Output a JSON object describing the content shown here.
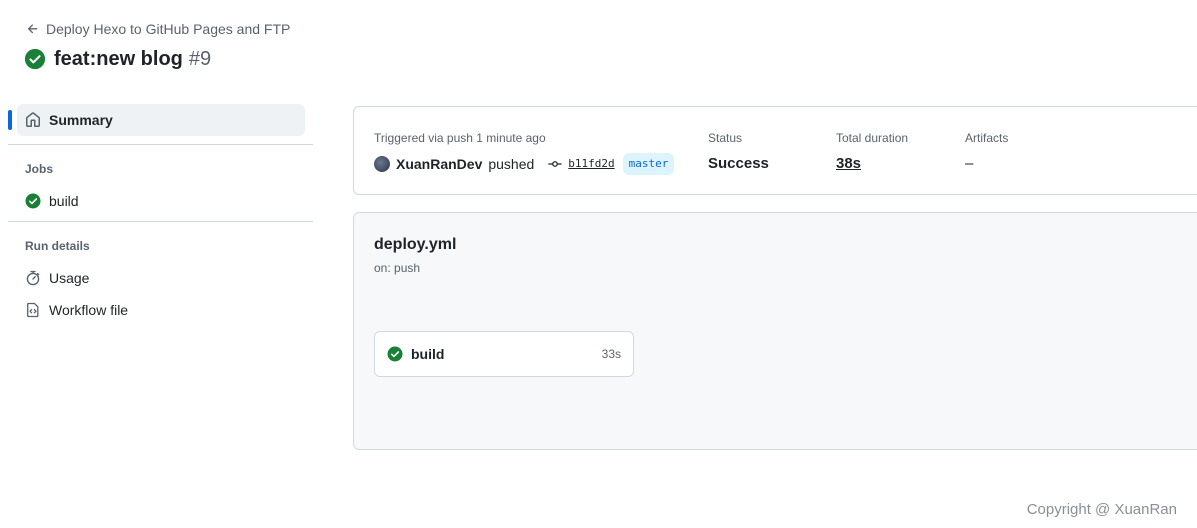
{
  "header": {
    "back_label": "Deploy Hexo to GitHub Pages and FTP",
    "run_title": "feat:new blog",
    "run_number": "#9",
    "status_icon": "check-circle-fill-icon",
    "success_color": "#1a7f37"
  },
  "sidebar": {
    "summary_label": "Summary",
    "jobs_heading": "Jobs",
    "jobs": [
      {
        "label": "build",
        "icon": "check-circle-fill-icon"
      }
    ],
    "run_details_heading": "Run details",
    "run_details": [
      {
        "label": "Usage",
        "icon": "stopwatch-icon"
      },
      {
        "label": "Workflow file",
        "icon": "file-code-icon"
      }
    ]
  },
  "summary": {
    "trigger_text": "Triggered via push 1 minute ago",
    "actor": "XuanRanDev",
    "action": "pushed",
    "commit_sha": "b11fd2d",
    "branch": "master",
    "status_label": "Status",
    "status_value": "Success",
    "duration_label": "Total duration",
    "duration_value": "38s",
    "artifacts_label": "Artifacts",
    "artifacts_value": "–"
  },
  "workflow": {
    "file_name": "deploy.yml",
    "trigger": "on: push",
    "jobs": [
      {
        "name": "build",
        "duration": "33s",
        "icon": "check-circle-fill-icon"
      }
    ]
  },
  "footer": {
    "copyright": "Copyright @ XuanRan"
  }
}
